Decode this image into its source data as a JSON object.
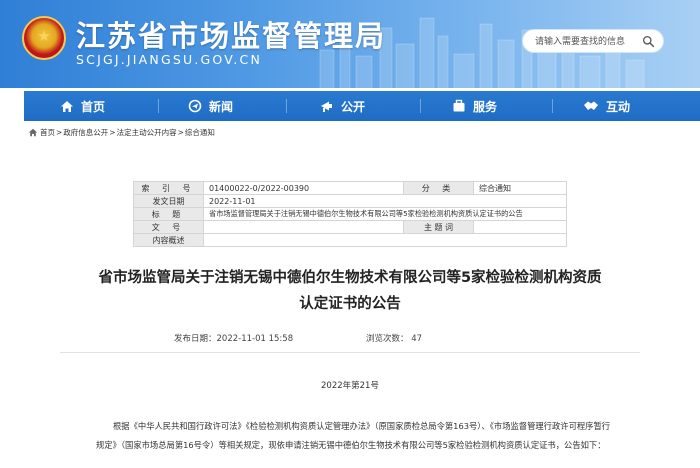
{
  "header": {
    "site_title": "江苏省市场监督管理局",
    "site_domain": "SCJGJ.JIANGSU.GOV.CN",
    "search_placeholder": "请输入需要查找的信息"
  },
  "nav": {
    "items": [
      {
        "label": "首页",
        "icon": "home-icon"
      },
      {
        "label": "新闻",
        "icon": "news-icon"
      },
      {
        "label": "公开",
        "icon": "open-icon"
      },
      {
        "label": "服务",
        "icon": "service-icon"
      },
      {
        "label": "互动",
        "icon": "handshake-icon"
      }
    ]
  },
  "breadcrumb": {
    "items": [
      "首页",
      "政府信息公开",
      "法定主动公开内容",
      "综合通知"
    ],
    "separator": ">"
  },
  "info_table": {
    "index_label": "索 引 号",
    "index_value": "01400022-0/2022-00390",
    "category_label": "分 类",
    "category_value": "综合通知",
    "date_label": "发文日期",
    "date_value": "2022-11-01",
    "title_label": "标 题",
    "title_value": "省市场监督管理局关于注销无锡中德伯尔生物技术有限公司等5家检验检测机构资质认定证书的公告",
    "docno_label": "文 号",
    "docno_value": "",
    "subject_label": "主 题 词",
    "subject_value": "",
    "summary_label": "内容概述",
    "summary_value": ""
  },
  "article": {
    "title_line1": "省市场监管局关于注销无锡中德伯尔生物技术有限公司等5家检验检测机构资质",
    "title_line2": "认定证书的公告",
    "published": "发布日期：2022-11-01 15:58",
    "views": "浏览次数： 47",
    "doc_number": "2022年第21号",
    "body": "根据《中华人民共和国行政许可法》《检验检测机构资质认定管理办法》（原国家质检总局令第163号）、《市场监督管理行政许可程序暂行规定》（国家市场总局第16号令）等相关规定，现依申请注销无锡中德伯尔生物技术有限公司等5家检验检测机构资质认定证书，公告如下："
  },
  "colors": {
    "header_blue": "#2f7fd6",
    "nav_blue": "#1f6cc4",
    "table_label_bg": "#e9e9e9"
  }
}
